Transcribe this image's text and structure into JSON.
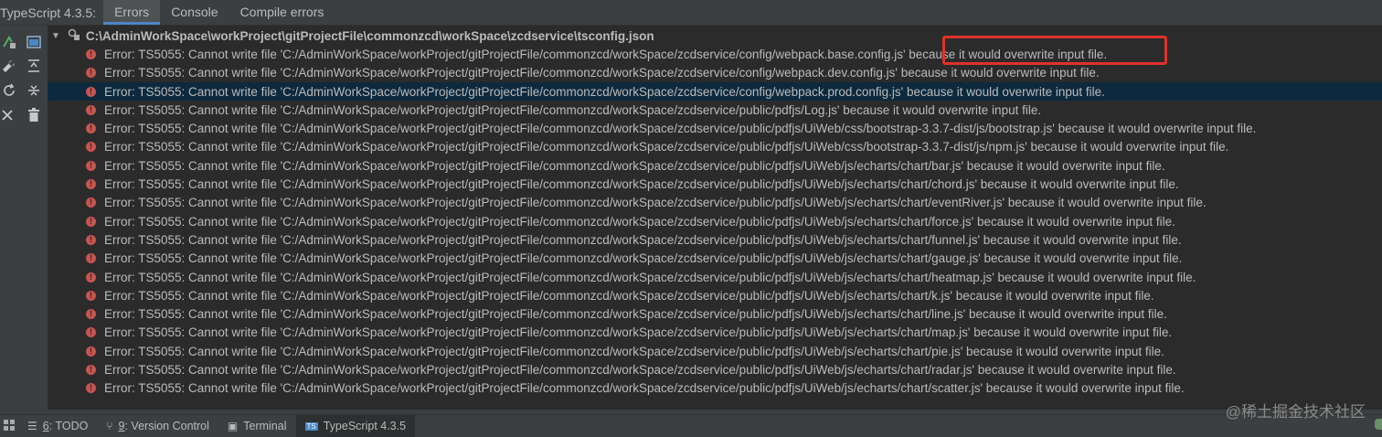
{
  "panel": {
    "title": "TypeScript 4.3.5:",
    "tabs": [
      {
        "label": "Errors",
        "active": true
      },
      {
        "label": "Console",
        "active": false
      },
      {
        "label": "Compile errors",
        "active": false
      }
    ]
  },
  "tree": {
    "root": "C:\\AdminWorkSpace\\workProject\\gitProjectFile\\commonzcd\\workSpace\\zcdservice\\tsconfig.json",
    "errors": [
      "Error: TS5055: Cannot write file 'C:/AdminWorkSpace/workProject/gitProjectFile/commonzcd/workSpace/zcdservice/config/webpack.base.config.js' because it would overwrite input file.",
      "Error: TS5055: Cannot write file 'C:/AdminWorkSpace/workProject/gitProjectFile/commonzcd/workSpace/zcdservice/config/webpack.dev.config.js' because it would overwrite input file.",
      "Error: TS5055: Cannot write file 'C:/AdminWorkSpace/workProject/gitProjectFile/commonzcd/workSpace/zcdservice/config/webpack.prod.config.js' because it would overwrite input file.",
      "Error: TS5055: Cannot write file 'C:/AdminWorkSpace/workProject/gitProjectFile/commonzcd/workSpace/zcdservice/public/pdfjs/Log.js' because it would overwrite input file.",
      "Error: TS5055: Cannot write file 'C:/AdminWorkSpace/workProject/gitProjectFile/commonzcd/workSpace/zcdservice/public/pdfjs/UiWeb/css/bootstrap-3.3.7-dist/js/bootstrap.js' because it would overwrite input file.",
      "Error: TS5055: Cannot write file 'C:/AdminWorkSpace/workProject/gitProjectFile/commonzcd/workSpace/zcdservice/public/pdfjs/UiWeb/css/bootstrap-3.3.7-dist/js/npm.js' because it would overwrite input file.",
      "Error: TS5055: Cannot write file 'C:/AdminWorkSpace/workProject/gitProjectFile/commonzcd/workSpace/zcdservice/public/pdfjs/UiWeb/js/echarts/chart/bar.js' because it would overwrite input file.",
      "Error: TS5055: Cannot write file 'C:/AdminWorkSpace/workProject/gitProjectFile/commonzcd/workSpace/zcdservice/public/pdfjs/UiWeb/js/echarts/chart/chord.js' because it would overwrite input file.",
      "Error: TS5055: Cannot write file 'C:/AdminWorkSpace/workProject/gitProjectFile/commonzcd/workSpace/zcdservice/public/pdfjs/UiWeb/js/echarts/chart/eventRiver.js' because it would overwrite input file.",
      "Error: TS5055: Cannot write file 'C:/AdminWorkSpace/workProject/gitProjectFile/commonzcd/workSpace/zcdservice/public/pdfjs/UiWeb/js/echarts/chart/force.js' because it would overwrite input file.",
      "Error: TS5055: Cannot write file 'C:/AdminWorkSpace/workProject/gitProjectFile/commonzcd/workSpace/zcdservice/public/pdfjs/UiWeb/js/echarts/chart/funnel.js' because it would overwrite input file.",
      "Error: TS5055: Cannot write file 'C:/AdminWorkSpace/workProject/gitProjectFile/commonzcd/workSpace/zcdservice/public/pdfjs/UiWeb/js/echarts/chart/gauge.js' because it would overwrite input file.",
      "Error: TS5055: Cannot write file 'C:/AdminWorkSpace/workProject/gitProjectFile/commonzcd/workSpace/zcdservice/public/pdfjs/UiWeb/js/echarts/chart/heatmap.js' because it would overwrite input file.",
      "Error: TS5055: Cannot write file 'C:/AdminWorkSpace/workProject/gitProjectFile/commonzcd/workSpace/zcdservice/public/pdfjs/UiWeb/js/echarts/chart/k.js' because it would overwrite input file.",
      "Error: TS5055: Cannot write file 'C:/AdminWorkSpace/workProject/gitProjectFile/commonzcd/workSpace/zcdservice/public/pdfjs/UiWeb/js/echarts/chart/line.js' because it would overwrite input file.",
      "Error: TS5055: Cannot write file 'C:/AdminWorkSpace/workProject/gitProjectFile/commonzcd/workSpace/zcdservice/public/pdfjs/UiWeb/js/echarts/chart/map.js' because it would overwrite input file.",
      "Error: TS5055: Cannot write file 'C:/AdminWorkSpace/workProject/gitProjectFile/commonzcd/workSpace/zcdservice/public/pdfjs/UiWeb/js/echarts/chart/pie.js' because it would overwrite input file.",
      "Error: TS5055: Cannot write file 'C:/AdminWorkSpace/workProject/gitProjectFile/commonzcd/workSpace/zcdservice/public/pdfjs/UiWeb/js/echarts/chart/radar.js' because it would overwrite input file.",
      "Error: TS5055: Cannot write file 'C:/AdminWorkSpace/workProject/gitProjectFile/commonzcd/workSpace/zcdservice/public/pdfjs/UiWeb/js/echarts/chart/scatter.js' because it would overwrite input file."
    ],
    "selected_index": 2
  },
  "bottom": {
    "tabs": [
      {
        "key": "6",
        "label": ": TODO",
        "icon": "list-icon"
      },
      {
        "key": "9",
        "label": ": Version Control",
        "icon": "branch-icon"
      },
      {
        "key": "",
        "label": "Terminal",
        "icon": "terminal-icon"
      },
      {
        "key": "",
        "label": "TypeScript 4.3.5",
        "icon": "typescript-icon",
        "active": true
      }
    ]
  },
  "watermark": "@稀土掘金技术社区",
  "colors": {
    "error": "#c75450",
    "highlight": "#e0312b",
    "selected_row": "#0d293e"
  }
}
